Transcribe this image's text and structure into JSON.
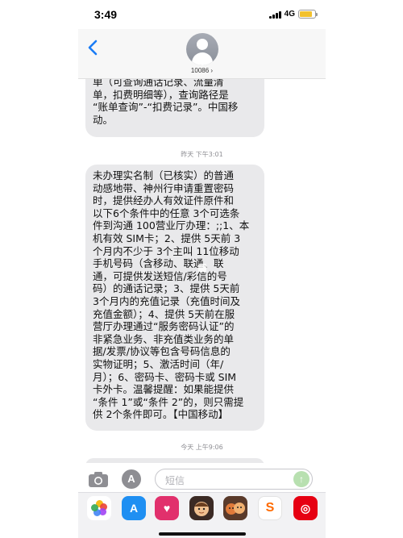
{
  "status_bar": {
    "time": "3:49",
    "network": "4G",
    "battery_level": 0.85,
    "battery_color": "#f2c12e"
  },
  "header": {
    "back_icon": "chevron-left-icon",
    "contact_number": "10086 ›",
    "accent_color": "#1a7cf5"
  },
  "messages": [
    {
      "text": "单（可查询通话记录、流量清\n单，扣费明细等），查询路径是\n“账单查询”-“扣费记录”。中国移\n动。"
    },
    {
      "text": "未办理实名制（已核实）的普通\n动感地带、神州行申请重置密码\n时，提供经办人有效证件原件和\n以下6个条件中的任意 3个可选条\n件到沟通 100营业厅办理：;;1、本\n机有效 SIM卡；2、提供 5天前 3\n个月内不少于 3个主叫 11位移动\n手机号码（含移动、联通、联\n通，可提供发送短信/彩信的号\n码）的通话记录；3、提供 5天前\n3个月内的充值记录（充值时间及\n充值金额）；4、提供 5天前在服\n营厅办理通过“服务密码认证”的\n非紧急业务、非充值类业务的单\n据/发票/协议等包含号码信息的\n实物证明；5、激活时间（年/\n月）；6、密码卡、密码卡或 SIM\n卡外卡。温馨提醒：如果能提供\n“条件 1”或“条件 2”的，则只需提\n供 2个条件即可。【中国移动】"
    },
    {
      "text": ""
    }
  ],
  "timestamps": [
    "昨天 下午3:01",
    "今天 上午9:06"
  ],
  "input_bar": {
    "placeholder": "短信",
    "appstore_glyph": "A",
    "send_glyph": "↑"
  },
  "app_drawer": {
    "apps": [
      {
        "icon": "photos-icon"
      },
      {
        "icon": "app-store-icon",
        "glyph": "A"
      },
      {
        "icon": "heart-app-icon",
        "glyph": "♥"
      },
      {
        "icon": "memoji-icon"
      },
      {
        "icon": "memoji-stickers-icon"
      },
      {
        "icon": "sougou-icon",
        "glyph": "S"
      },
      {
        "icon": "netease-music-icon",
        "glyph": "◎"
      }
    ]
  }
}
